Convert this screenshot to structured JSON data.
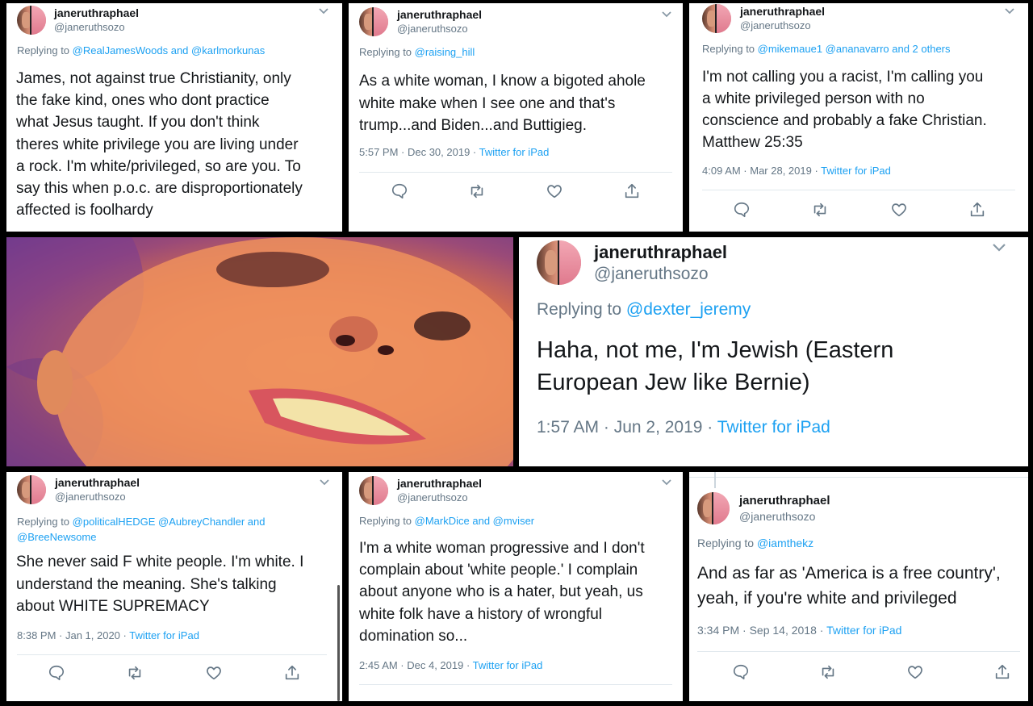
{
  "tweets": [
    {
      "name": "janeruthraphael",
      "handle": "@janeruthsozo",
      "replying_prefix": "Replying to ",
      "replying_to": "@RealJamesWoods and @karlmorkunas",
      "text": "James, not against true Christianity, only\nthe fake kind, ones who dont practice\nwhat Jesus taught. If you don't think\ntheres white privilege you are living under\na rock. I'm white/privileged, so are you. To\nsay this when p.o.c. are disproportionately\naffected is foolhardy",
      "time": "",
      "source": ""
    },
    {
      "name": "janeruthraphael",
      "handle": "@janeruthsozo",
      "replying_prefix": "Replying to ",
      "replying_to": "@raising_hill",
      "text": "As a white woman, I know a bigoted ahole\nwhite make when I see one and that's\ntrump...and Biden...and Buttigieg.",
      "time": "5:57 PM · Dec 30, 2019 · ",
      "source": "Twitter for iPad"
    },
    {
      "name": "janeruthraphael",
      "handle": "@janeruthsozo",
      "replying_prefix": "Replying to ",
      "replying_to": "@mikemaue1 @ananavarro and 2 others",
      "text": "I'm not calling you a racist, I'm calling you\na white privileged person with no\nconscience and probably a fake Christian.\nMatthew 25:35",
      "time": "4:09 AM · Mar 28, 2019 · ",
      "source": "Twitter for iPad"
    },
    {
      "name": "janeruthraphael",
      "handle": "@janeruthsozo",
      "replying_prefix": "Replying to ",
      "replying_to": "@dexter_jeremy",
      "text": "Haha, not me, I'm Jewish (Eastern\nEuropean Jew like Bernie)",
      "time": "1:57 AM · Jun 2, 2019 · ",
      "source": "Twitter for iPad"
    },
    {
      "name": "janeruthraphael",
      "handle": "@janeruthsozo",
      "replying_prefix": "Replying to ",
      "replying_to": "@politicalHEDGE @AubreyChandler and\n@BreeNewsome",
      "text": "She never said F white people. I'm white. I\nunderstand the meaning. She's talking\nabout WHITE SUPREMACY",
      "time": "8:38 PM · Jan 1, 2020 · ",
      "source": "Twitter for iPad"
    },
    {
      "name": "janeruthraphael",
      "handle": "@janeruthsozo",
      "replying_prefix": "Replying to ",
      "replying_to": "@MarkDice and @mviser",
      "text": "I'm a white woman progressive and I don't\ncomplain about 'white people.' I complain\nabout anyone who is a hater, but yeah, us\nwhite folk have a history of wrongful\ndomination so...",
      "time": "2:45 AM · Dec 4, 2019 · ",
      "source": "Twitter for iPad"
    },
    {
      "name": "janeruthraphael",
      "handle": "@janeruthsozo",
      "replying_prefix": "Replying to ",
      "replying_to": "@iamthekz",
      "text": "And as far as 'America is a free country',\nyeah, if you're white and privileged",
      "time": "3:34 PM · Sep 14, 2018 · ",
      "source": "Twitter for iPad"
    }
  ],
  "icons": [
    "chevron-down-icon",
    "reply-icon",
    "retweet-icon",
    "like-icon",
    "share-icon"
  ],
  "colors": {
    "link": "#1da1f2",
    "secondary": "#657786",
    "text": "#14171a",
    "background": "#000000",
    "divider": "#e1e8ed"
  }
}
